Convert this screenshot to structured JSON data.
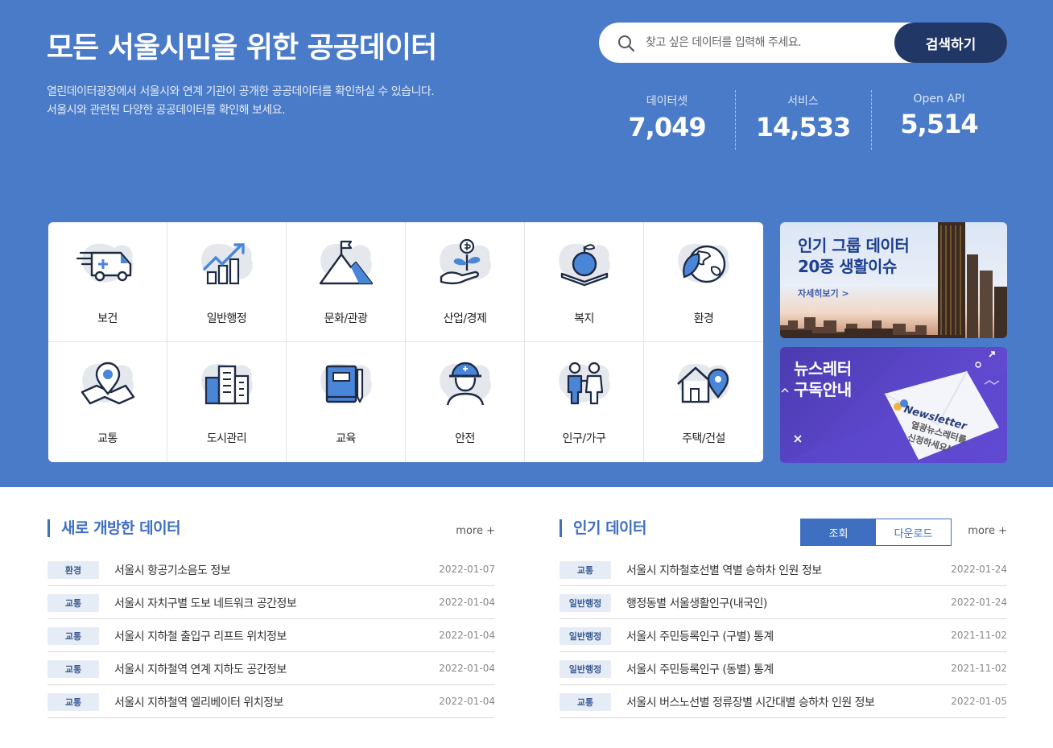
{
  "hero": {
    "title": "모든 서울시민을 위한 공공데이터",
    "desc_line1": "열린데이터광장에서 서울시와 연계 기관이 공개한 공공데이터를 확인하실 수 있습니다.",
    "desc_line2": "서울시와 관련된 다양한 공공데이터를 확인해 보세요."
  },
  "search": {
    "placeholder": "찾고 싶은 데이터를 입력해 주세요.",
    "button": "검색하기"
  },
  "stats": [
    {
      "label": "데이터셋",
      "value": "7,049"
    },
    {
      "label": "서비스",
      "value": "14,533"
    },
    {
      "label": "Open API",
      "value": "5,514"
    }
  ],
  "categories": [
    {
      "label": "보건",
      "icon": "ambulance-icon"
    },
    {
      "label": "일반행정",
      "icon": "rising-chart-icon"
    },
    {
      "label": "문화/관광",
      "icon": "mountain-flag-icon"
    },
    {
      "label": "산업/경제",
      "icon": "money-plant-icon"
    },
    {
      "label": "복지",
      "icon": "apple-book-icon"
    },
    {
      "label": "환경",
      "icon": "earth-leaf-icon"
    },
    {
      "label": "교통",
      "icon": "map-pin-icon"
    },
    {
      "label": "도시관리",
      "icon": "buildings-icon"
    },
    {
      "label": "교육",
      "icon": "book-pencil-icon"
    },
    {
      "label": "안전",
      "icon": "helmet-worker-icon"
    },
    {
      "label": "인구/가구",
      "icon": "family-icon"
    },
    {
      "label": "주택/건설",
      "icon": "house-pin-icon"
    }
  ],
  "banners": {
    "popular": {
      "line1": "인기 그룹 데이터",
      "line2": "20종 생활이슈",
      "more": "자세히보기 >"
    },
    "newsletter": {
      "line1": "뉴스레터",
      "line2": "구독안내",
      "card_title": "Newsletter",
      "card_line1": "열광뉴스레터를",
      "card_line2": "신청하세요!"
    }
  },
  "new_data": {
    "title": "새로 개방한 데이터",
    "more": "more +",
    "rows": [
      {
        "tag": "환경",
        "title": "서울시 항공기소음도 정보",
        "date": "2022-01-07"
      },
      {
        "tag": "교통",
        "title": "서울시 자치구별 도보 네트워크 공간정보",
        "date": "2022-01-04"
      },
      {
        "tag": "교통",
        "title": "서울시 지하철 출입구 리프트 위치정보",
        "date": "2022-01-04"
      },
      {
        "tag": "교통",
        "title": "서울시 지하철역 연계 지하도 공간정보",
        "date": "2022-01-04"
      },
      {
        "tag": "교통",
        "title": "서울시 지하철역 엘리베이터 위치정보",
        "date": "2022-01-04"
      }
    ]
  },
  "popular_data": {
    "title": "인기 데이터",
    "more": "more +",
    "tabs": [
      "조회",
      "다운로드"
    ],
    "active_tab": "조회",
    "rows": [
      {
        "tag": "교통",
        "title": "서울시 지하철호선별 역별 승하차 인원 정보",
        "date": "2022-01-24"
      },
      {
        "tag": "일반행정",
        "title": "행정동별 서울생활인구(내국인)",
        "date": "2022-01-24"
      },
      {
        "tag": "일반행정",
        "title": "서울시 주민등록인구 (구별) 통계",
        "date": "2021-11-02"
      },
      {
        "tag": "일반행정",
        "title": "서울시 주민등록인구 (동별) 통계",
        "date": "2021-11-02"
      },
      {
        "tag": "교통",
        "title": "서울시 버스노선별 정류장별 시간대별 승하차 인원 정보",
        "date": "2022-01-05"
      }
    ]
  },
  "colors": {
    "hero_bg": "#4a7bc8",
    "accent": "#3f6fc0",
    "search_button": "#213766",
    "icon_dark": "#1e2a44",
    "icon_blue": "#4a86d8"
  }
}
